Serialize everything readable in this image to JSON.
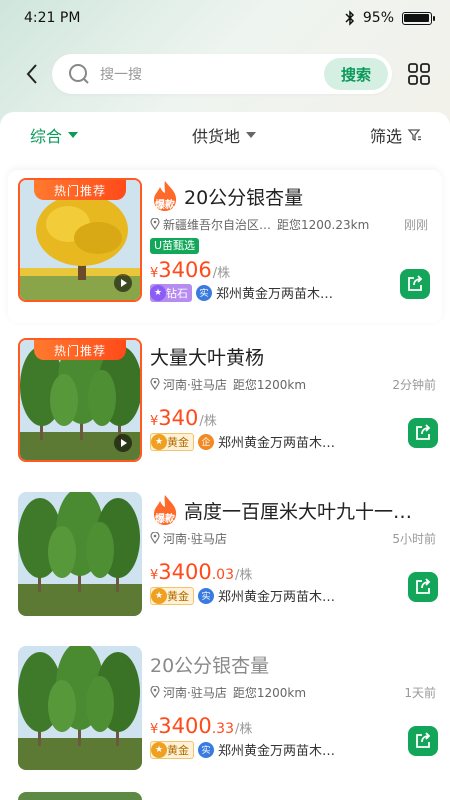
{
  "status": {
    "time": "4:21 PM",
    "battery": "95%",
    "battery_level": 0.95
  },
  "search": {
    "placeholder": "搜一搜",
    "button": "搜索"
  },
  "filters": [
    {
      "label": "综合",
      "active": true
    },
    {
      "label": "供货地",
      "active": false
    },
    {
      "label": "筛选",
      "active": false
    }
  ],
  "items": [
    {
      "hot_tag": "热门推荐",
      "flame": "爆款",
      "title": "20公分银杏量",
      "location": "新疆维吾尔自治区…",
      "distance": "距您1200.23km",
      "time": "刚刚",
      "badge": "U苗甄选",
      "price_cur": "¥",
      "price_int": "3406",
      "price_dec": "",
      "price_unit": "/株",
      "level": "钻石",
      "verify": "实",
      "seller": "郑州黄金万两苗木…"
    },
    {
      "hot_tag": "热门推荐",
      "flame": "",
      "title": "大量大叶黄杨",
      "location": "河南·驻马店",
      "distance": "距您1200km",
      "time": "2分钟前",
      "badge": "",
      "price_cur": "¥",
      "price_int": "340",
      "price_dec": "",
      "price_unit": "/株",
      "level": "黄金",
      "verify": "企",
      "seller": "郑州黄金万两苗木…"
    },
    {
      "hot_tag": "",
      "flame": "爆款",
      "title": "高度一百厘米大叶九十一…",
      "location": "河南·驻马店",
      "distance": "",
      "time": "5小时前",
      "badge": "",
      "price_cur": "¥",
      "price_int": "3400",
      "price_dec": ".03",
      "price_unit": "/株",
      "level": "黄金",
      "verify": "实",
      "seller": "郑州黄金万两苗木…"
    },
    {
      "hot_tag": "",
      "flame": "",
      "title": "20公分银杏量",
      "location": "河南·驻马店",
      "distance": "距您1200km",
      "time": "1天前",
      "badge": "",
      "price_cur": "¥",
      "price_int": "3400",
      "price_dec": ".33",
      "price_unit": "/株",
      "level": "黄金",
      "verify": "实",
      "seller": "郑州黄金万两苗木…"
    }
  ],
  "colors": {
    "accent": "#0b9a5a",
    "price": "#ff4a1a",
    "hot": "#ff5a1f"
  },
  "icons": [
    "back-icon",
    "search-icon",
    "grid-icon",
    "filter-icon",
    "pin-icon",
    "play-icon",
    "share-icon",
    "bluetooth-icon",
    "battery-icon"
  ]
}
